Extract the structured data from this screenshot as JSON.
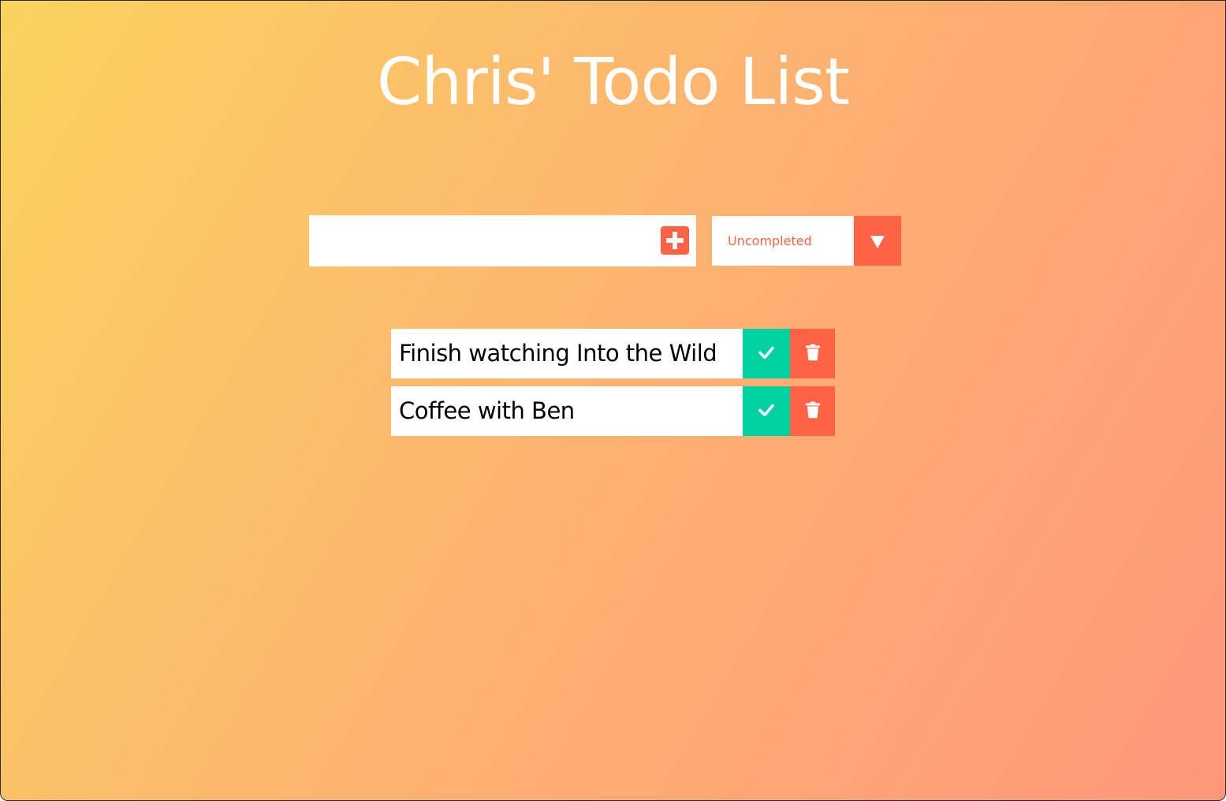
{
  "header": {
    "title": "Chris' Todo List"
  },
  "form": {
    "input_value": "",
    "add_icon": "plus-square-icon"
  },
  "filter": {
    "selected": "Uncompleted",
    "arrow_icon": "caret-down-icon"
  },
  "todos": [
    {
      "text": "Finish watching Into the Wild",
      "complete_icon": "check-icon",
      "delete_icon": "trash-icon"
    },
    {
      "text": "Coffee with Ben",
      "complete_icon": "check-icon",
      "delete_icon": "trash-icon"
    }
  ],
  "colors": {
    "accent": "#ff6347",
    "complete": "#00d1a0",
    "gradient_start": "#f9d35e",
    "gradient_end": "#ff977b"
  }
}
